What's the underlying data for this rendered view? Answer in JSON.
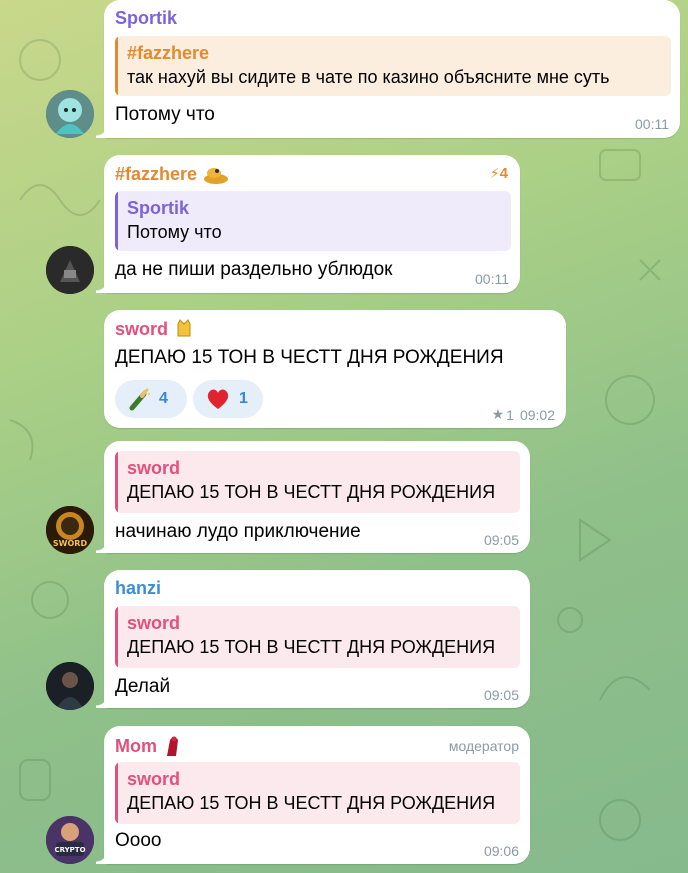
{
  "messages": [
    {
      "sender": "Sportik",
      "sender_color": "#7d62d9",
      "reply": {
        "name": "#fazzhere",
        "text": "так нахуй вы сидите в чате по казино объясните мне суть",
        "color": "#e28a2f"
      },
      "text": "Потому что",
      "time": "00:11"
    },
    {
      "sender": "#fazzhere",
      "sender_color": "#e28a2f",
      "badge": "4",
      "reply": {
        "name": "Sportik",
        "text": "Потому что",
        "color": "#7d62d9"
      },
      "text": "да не пиши раздельно ублюдок",
      "time": "00:11"
    },
    {
      "sender": "sword",
      "sender_color": "#e2507b",
      "text": "ДЕПАЮ 15 ТОН В ЧЕСТТ ДНЯ РОЖДЕНИЯ",
      "reactions": [
        {
          "icon": "champagne-icon",
          "count": "4"
        },
        {
          "icon": "heart-icon",
          "count": "1"
        }
      ],
      "views": "1",
      "time": "09:02"
    },
    {
      "reply": {
        "name": "sword",
        "text": "ДЕПАЮ 15 ТОН В ЧЕСТТ ДНЯ РОЖДЕНИЯ",
        "color": "#e2507b"
      },
      "text": "начинаю лудо приключение",
      "time": "09:05"
    },
    {
      "sender": "hanzi",
      "sender_color": "#3a8fd6",
      "reply": {
        "name": "sword",
        "text": "ДЕПАЮ 15 ТОН В ЧЕСТТ ДНЯ РОЖДЕНИЯ",
        "color": "#e2507b"
      },
      "text": "Делай",
      "time": "09:05"
    },
    {
      "sender": "Mom",
      "sender_color": "#e2507b",
      "role": "модератор",
      "reply": {
        "name": "sword",
        "text": "ДЕПАЮ 15 ТОН В ЧЕСТТ ДНЯ РОЖДЕНИЯ",
        "color": "#e2507b"
      },
      "text": "Оооо",
      "time": "09:06"
    }
  ],
  "avatars": {
    "sword_avatar_text": "SWORD",
    "mom_avatar_text": "CRYPTO"
  }
}
